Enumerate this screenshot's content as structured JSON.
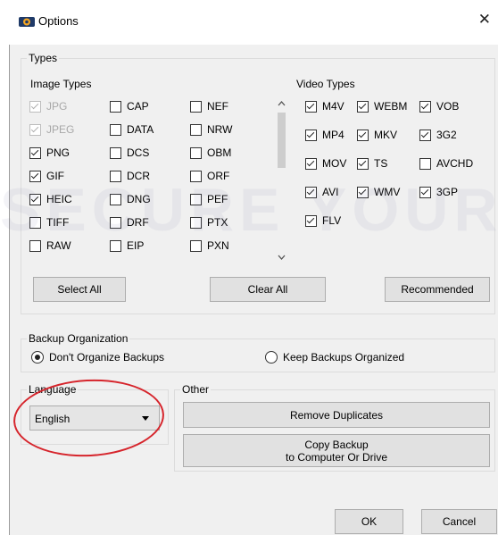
{
  "window": {
    "title": "Options",
    "close_label": "✕"
  },
  "types": {
    "label": "Types",
    "image_types_label": "Image Types",
    "video_types_label": "Video Types",
    "image_items": [
      {
        "label": "JPG",
        "checked": true,
        "disabled": true
      },
      {
        "label": "JPEG",
        "checked": true,
        "disabled": true
      },
      {
        "label": "PNG",
        "checked": true
      },
      {
        "label": "GIF",
        "checked": true
      },
      {
        "label": "HEIC",
        "checked": true
      },
      {
        "label": "TIFF",
        "checked": false
      },
      {
        "label": "RAW",
        "checked": false
      },
      {
        "label": "CAP",
        "checked": false
      },
      {
        "label": "DATA",
        "checked": false
      },
      {
        "label": "DCS",
        "checked": false
      },
      {
        "label": "DCR",
        "checked": false
      },
      {
        "label": "DNG",
        "checked": false
      },
      {
        "label": "DRF",
        "checked": false
      },
      {
        "label": "EIP",
        "checked": false
      },
      {
        "label": "NEF",
        "checked": false
      },
      {
        "label": "NRW",
        "checked": false
      },
      {
        "label": "OBM",
        "checked": false
      },
      {
        "label": "ORF",
        "checked": false
      },
      {
        "label": "PEF",
        "checked": false
      },
      {
        "label": "PTX",
        "checked": false
      },
      {
        "label": "PXN",
        "checked": false
      }
    ],
    "video_items": [
      {
        "label": "M4V",
        "checked": true
      },
      {
        "label": "WEBM",
        "checked": true
      },
      {
        "label": "VOB",
        "checked": true
      },
      {
        "label": "MP4",
        "checked": true
      },
      {
        "label": "MKV",
        "checked": true
      },
      {
        "label": "3G2",
        "checked": true
      },
      {
        "label": "MOV",
        "checked": true
      },
      {
        "label": "TS",
        "checked": true
      },
      {
        "label": "AVCHD",
        "checked": false
      },
      {
        "label": "AVI",
        "checked": true
      },
      {
        "label": "WMV",
        "checked": true
      },
      {
        "label": "3GP",
        "checked": true
      },
      {
        "label": "FLV",
        "checked": true
      }
    ],
    "select_all_label": "Select All",
    "clear_all_label": "Clear All",
    "recommended_label": "Recommended"
  },
  "backup_org": {
    "label": "Backup Organization",
    "option_dont": "Don't Organize Backups",
    "option_keep": "Keep Backups Organized",
    "selected": "dont"
  },
  "language": {
    "label": "Language",
    "value": "English"
  },
  "other": {
    "label": "Other",
    "remove_duplicates_label": "Remove Duplicates",
    "copy_backup_line1": "Copy Backup",
    "copy_backup_line2": "to Computer Or Drive"
  },
  "footer": {
    "ok_label": "OK",
    "cancel_label": "Cancel"
  },
  "colors": {
    "annotation": "#d6252c",
    "button_bg": "#e1e1e1",
    "dialog_bg": "#f0f0f0"
  },
  "watermark": {
    "text": "SECURE YOUR L"
  }
}
